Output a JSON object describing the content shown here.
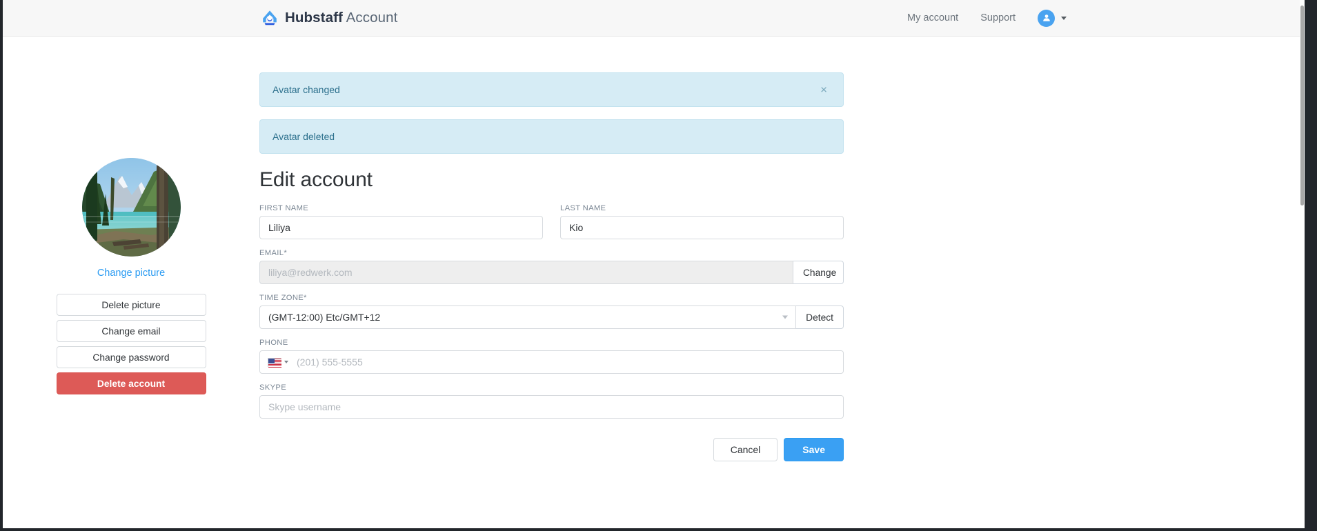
{
  "header": {
    "brand_bold": "Hubstaff",
    "brand_light": "Account",
    "nav": [
      {
        "label": "My account"
      },
      {
        "label": "Support"
      }
    ],
    "avatar_icon": "user-circle-icon",
    "caret_icon": "chevron-down-icon"
  },
  "alerts": [
    {
      "message": "Avatar changed",
      "dismissible": true,
      "close_label": "×"
    },
    {
      "message": "Avatar deleted",
      "dismissible": false,
      "close_label": ""
    }
  ],
  "sidebar": {
    "avatar_alt": "profile-photo-mountain-lake",
    "change_picture_label": "Change picture",
    "buttons": [
      {
        "label": "Delete picture",
        "style": "default"
      },
      {
        "label": "Change email",
        "style": "default"
      },
      {
        "label": "Change password",
        "style": "default"
      },
      {
        "label": "Delete account",
        "style": "danger"
      }
    ]
  },
  "form": {
    "title": "Edit account",
    "first_name": {
      "label": "FIRST NAME",
      "value": "Liliya",
      "placeholder": ""
    },
    "last_name": {
      "label": "LAST NAME",
      "value": "Kio",
      "placeholder": ""
    },
    "email": {
      "label": "EMAIL*",
      "value": "",
      "placeholder": "liliya@redwerk.com",
      "disabled": true,
      "button_label": "Change"
    },
    "timezone": {
      "label": "TIME ZONE*",
      "value": "(GMT-12:00) Etc/GMT+12",
      "button_label": "Detect",
      "caret_icon": "chevron-down-icon"
    },
    "phone": {
      "label": "PHONE",
      "value": "",
      "placeholder": "(201) 555-5555",
      "country_flag": "us-flag-icon",
      "caret_icon": "chevron-down-icon"
    },
    "skype": {
      "label": "SKYPE",
      "value": "",
      "placeholder": "Skype username"
    },
    "cancel_label": "Cancel",
    "save_label": "Save"
  },
  "colors": {
    "brand_blue": "#2a9bf2",
    "primary_button": "#3aa0f3",
    "danger_button": "#dd5a57",
    "alert_background": "#d6ecf5",
    "alert_text": "#2b6f8c",
    "header_background": "#f7f7f7"
  }
}
